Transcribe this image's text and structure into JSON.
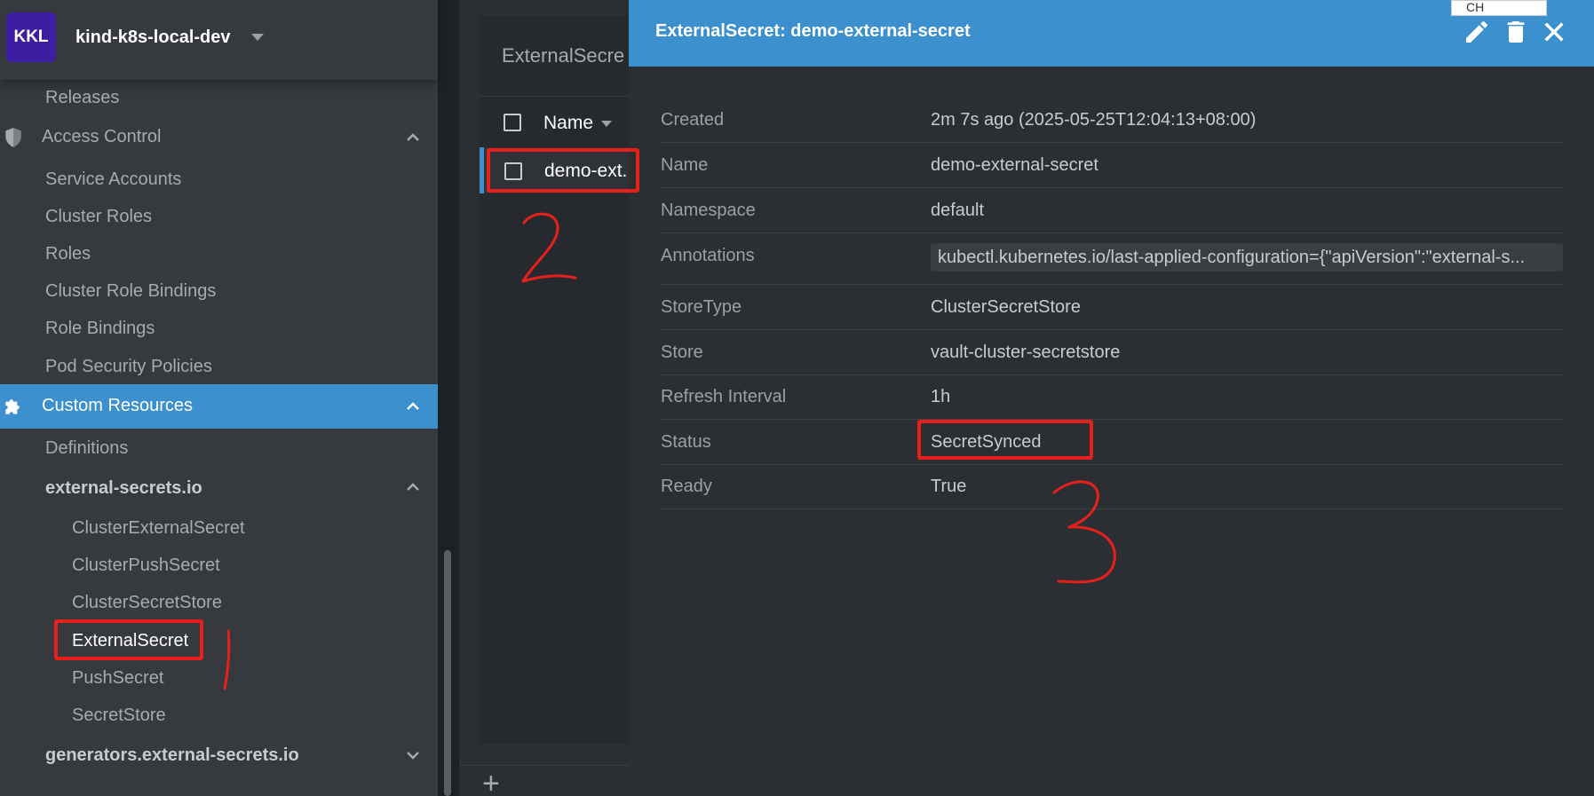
{
  "cluster": {
    "avatar_text": "KKL",
    "name": "kind-k8s-local-dev"
  },
  "sidebar": {
    "releases": "Releases",
    "access_control": {
      "label": "Access Control",
      "items": [
        "Service Accounts",
        "Cluster Roles",
        "Roles",
        "Cluster Role Bindings",
        "Role Bindings",
        "Pod Security Policies"
      ]
    },
    "custom_resources": {
      "label": "Custom Resources",
      "definitions": "Definitions",
      "group_external_secrets": "external-secrets.io",
      "external_secrets_items": [
        "ClusterExternalSecret",
        "ClusterPushSecret",
        "ClusterSecretStore",
        "ExternalSecret",
        "PushSecret",
        "SecretStore"
      ],
      "group_generators": "generators.external-secrets.io"
    }
  },
  "list": {
    "title": "ExternalSecre",
    "column_name": "Name",
    "rows": [
      {
        "name": "demo-ext..."
      }
    ]
  },
  "drawer": {
    "title": "ExternalSecret: demo-external-secret",
    "fields": [
      {
        "key": "Created",
        "value": "2m 7s ago (2025-05-25T12:04:13+08:00)"
      },
      {
        "key": "Name",
        "value": "demo-external-secret"
      },
      {
        "key": "Namespace",
        "value": "default"
      },
      {
        "key": "Annotations",
        "value": "kubectl.kubernetes.io/last-applied-configuration={\"apiVersion\":\"external-s..."
      },
      {
        "key": "StoreType",
        "value": "ClusterSecretStore"
      },
      {
        "key": "Store",
        "value": "vault-cluster-secretstore"
      },
      {
        "key": "Refresh Interval",
        "value": "1h"
      },
      {
        "key": "Status",
        "value": "SecretSynced"
      },
      {
        "key": "Ready",
        "value": "True"
      }
    ]
  },
  "ime_indicator": "CH",
  "colors": {
    "accent": "#3d90ce",
    "avatar": "#3d1ea3",
    "annotation_red": "#e8201c"
  }
}
